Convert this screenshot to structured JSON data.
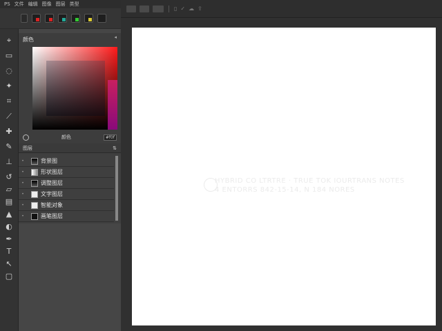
{
  "menu": [
    "PS",
    "文件",
    "编辑",
    "图像",
    "图层",
    "类型"
  ],
  "color_panel": {
    "title": "颜色",
    "hex": "#f0f",
    "footer_label": "颜色",
    "gradient": {
      "top_left": "#ffffff",
      "top_right": "#ff1a1a",
      "bottom": "#000000",
      "accent": "#8a0a7a"
    }
  },
  "layers_panel": {
    "title": "图层",
    "items": [
      {
        "name": "背景图"
      },
      {
        "name": "形状图层"
      },
      {
        "name": "调整图层"
      },
      {
        "name": "文字图层"
      },
      {
        "name": "智能对象"
      },
      {
        "name": "画笔图层"
      }
    ]
  },
  "canvas": {
    "watermark_line1": "HYBRID CO LTRTRE · TRUE TOK IOURTRANS NOTES",
    "watermark_line2": "4 ENTORRS  842-15-14,  N 184 NORES"
  },
  "icons": {
    "tools": [
      "move-icon",
      "marquee-icon",
      "lasso-icon",
      "magic-wand-icon",
      "crop-icon",
      "eyedropper-icon",
      "healing-brush-icon",
      "brush-icon",
      "clone-stamp-icon",
      "history-brush-icon",
      "eraser-icon",
      "gradient-icon",
      "blur-icon",
      "dodge-icon",
      "pen-icon",
      "text-icon",
      "path-select-icon",
      "shape-icon"
    ]
  }
}
